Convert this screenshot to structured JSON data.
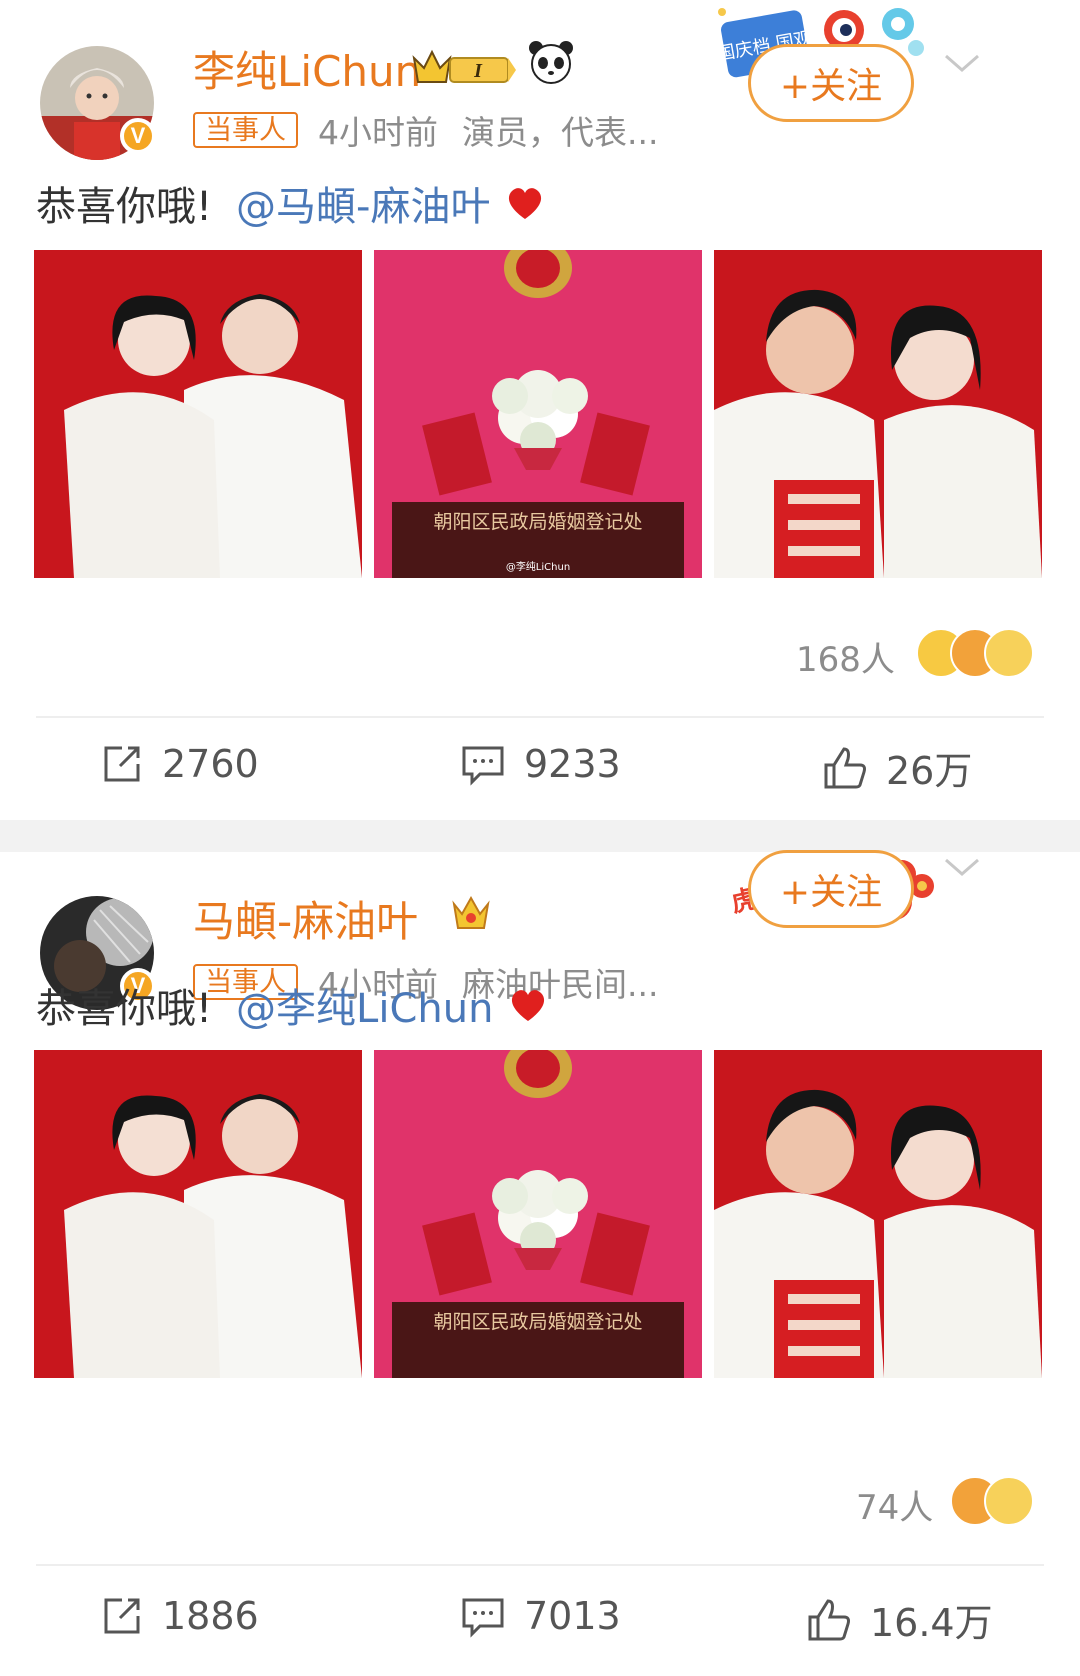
{
  "posts": [
    {
      "username": "李纯LiChun",
      "tag": "当事人",
      "time": "4小时前",
      "description": "演员，代表...",
      "follow_label": "+关注",
      "text": "恭喜你哦!",
      "mention": "@马頔-麻油叶",
      "reaction_count": "168人",
      "repost_count": "2760",
      "comment_count": "9233",
      "like_count": "26万",
      "level_badge": "I"
    },
    {
      "username": "马頔-麻油叶",
      "tag": "当事人",
      "time": "4小时前",
      "description": "麻油叶民间...",
      "follow_label": "+关注",
      "text": "恭喜你哦!",
      "mention": "@李纯LiChun",
      "reaction_count": "74人",
      "repost_count": "1886",
      "comment_count": "7013",
      "like_count": "16.4万"
    }
  ],
  "photo_texts": {
    "registry_sign": "朝阳区民政局婚姻登记处",
    "watermark": "@李纯LiChun"
  },
  "deco_texts": {
    "post1": "国庆档 国观",
    "post2": "虎一声"
  },
  "colors": {
    "username": "#e8791f",
    "mention": "#4a78b8",
    "photo_red": "#c8161d",
    "photo_pink": "#e0336a"
  },
  "icons": [
    "verified-icon",
    "crown-icon",
    "panda-icon",
    "chevron-down-icon",
    "heart-icon",
    "repost-icon",
    "comment-icon",
    "like-icon",
    "emoji-icon"
  ]
}
